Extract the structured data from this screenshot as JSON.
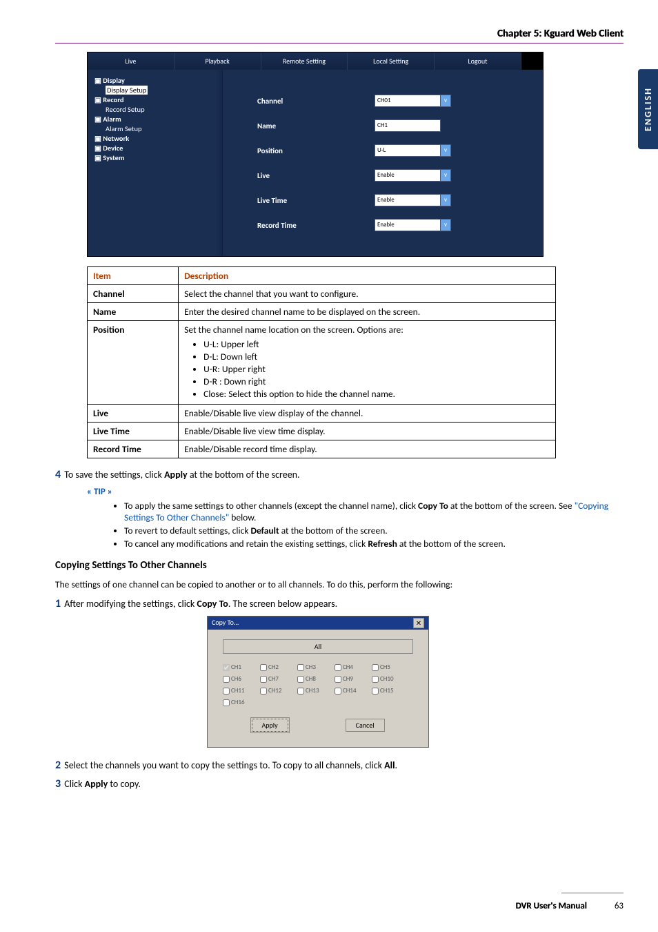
{
  "chapter": "Chapter 5: Kguard Web Client",
  "lang_tab": "ENGLISH",
  "shot1": {
    "tabs": [
      "Live",
      "Playback",
      "Remote Setting",
      "Local Setting",
      "Logout"
    ],
    "side": {
      "display": "Display",
      "display_setup": "Display Setup",
      "record": "Record",
      "record_setup": "Record Setup",
      "alarm": "Alarm",
      "alarm_setup": "Alarm Setup",
      "network": "Network",
      "device": "Device",
      "system": "System"
    },
    "rows": [
      {
        "label": "Channel",
        "value": "CH01",
        "drop": true
      },
      {
        "label": "Name",
        "value": "CH1",
        "drop": false
      },
      {
        "label": "Position",
        "value": "U-L",
        "drop": true
      },
      {
        "label": "Live",
        "value": "Enable",
        "drop": true
      },
      {
        "label": "Live Time",
        "value": "Enable",
        "drop": true
      },
      {
        "label": "Record Time",
        "value": "Enable",
        "drop": true
      }
    ]
  },
  "table": {
    "head_item": "Item",
    "head_desc": "Description",
    "rows": [
      {
        "item": "Channel",
        "desc": "Select the channel that you want to configure."
      },
      {
        "item": "Name",
        "desc": "Enter the desired channel name to be displayed on the screen."
      },
      {
        "item": "Position",
        "desc_intro": "Set the channel name location on the screen. Options are:",
        "opts": [
          "U-L: Upper left",
          "D-L: Down left",
          "U-R: Upper right",
          "D-R : Down right",
          "Close: Select this option to hide the channel name."
        ]
      },
      {
        "item": "Live",
        "desc": "Enable/Disable live view display of the channel."
      },
      {
        "item": "Live Time",
        "desc": "Enable/Disable live view time display."
      },
      {
        "item": "Record Time",
        "desc": "Enable/Disable record time display."
      }
    ]
  },
  "step4_pre": "To save the settings, click ",
  "step4_bold": "Apply",
  "step4_post": " at the bottom of the screen.",
  "tip_label": "« TIP »",
  "tips": {
    "t1a": "To apply the same settings to other channels (except the channel name), click ",
    "t1b": "Copy To",
    "t1c": " at the bottom of the screen. See ",
    "t1link": "\"Copying Settings To Other Channels\"",
    "t1d": " below.",
    "t2a": "To revert to default settings, click ",
    "t2b": "Default",
    "t2c": " at the bottom of the screen.",
    "t3a": "To cancel any modifications and retain the existing settings, click ",
    "t3b": "Refresh",
    "t3c": " at the bottom of the screen."
  },
  "section_heading": "Copying Settings To Other Channels",
  "section_para": "The settings of one channel can be copied to another or to all channels. To do this, perform the following:",
  "step1_pre": "After modifying the settings, click ",
  "step1_bold": "Copy To",
  "step1_post": ". The screen below appears.",
  "shot2": {
    "title": "Copy To...",
    "close": "✕",
    "all": "All",
    "channels": [
      "CH1",
      "CH2",
      "CH3",
      "CH4",
      "CH5",
      "CH6",
      "CH7",
      "CH8",
      "CH9",
      "CH10",
      "CH11",
      "CH12",
      "CH13",
      "CH14",
      "CH15",
      "CH16"
    ],
    "checked_first": true,
    "apply": "Apply",
    "cancel": "Cancel"
  },
  "step2_pre": "Select the channels you want to copy the settings to. To copy to all channels, click ",
  "step2_bold": "All",
  "step2_post": ".",
  "step3_pre": "Click ",
  "step3_bold": "Apply",
  "step3_post": " to copy.",
  "footer_manual": "DVR User's Manual",
  "page_no": "63",
  "nums": {
    "n1": "1",
    "n2": "2",
    "n3": "3",
    "n4": "4"
  }
}
